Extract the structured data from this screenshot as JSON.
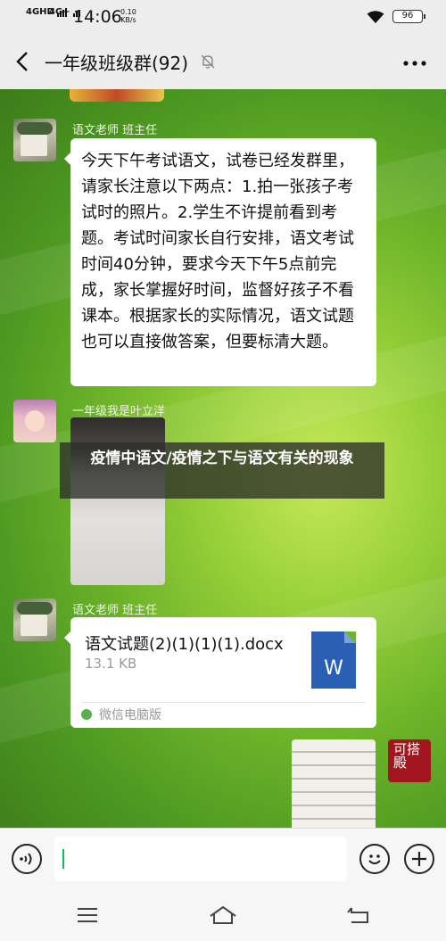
{
  "status_bar": {
    "network_1": "4GHD",
    "network_2": "4G+",
    "time": "14:06",
    "speed_value": "0.10",
    "speed_unit": "KB/s",
    "battery": "96"
  },
  "header": {
    "title": "一年级班级群(92)"
  },
  "messages": [
    {
      "sender": "语文老师 班主任",
      "text": "今天下午考试语文，试卷已经发群里，请家长注意以下两点：1.拍一张孩子考试时的照片。2.学生不许提前看到考题。考试时间家长自行安排，语文考试时间40分钟，要求今天下午5点前完成，家长掌握好时间，监督好孩子不看课本。根据家长的实际情况，语文试题也可以直接做答案，但要标清大题。"
    },
    {
      "sender": "一年级我是叶立洋"
    },
    {
      "sender": "语文老师 班主任",
      "file_name": "语文试题(2)(1)(1)(1).docx",
      "file_size": "13.1 KB",
      "file_icon": "W",
      "source": "微信电脑版"
    },
    {
      "avatar_text": "可搭殿"
    }
  ],
  "overlay_caption": "疫情中语文/疫情之下与语文有关的现象",
  "colors": {
    "accent": "#07c160",
    "word_blue": "#2b5fb3",
    "bubble": "#ffffff"
  }
}
